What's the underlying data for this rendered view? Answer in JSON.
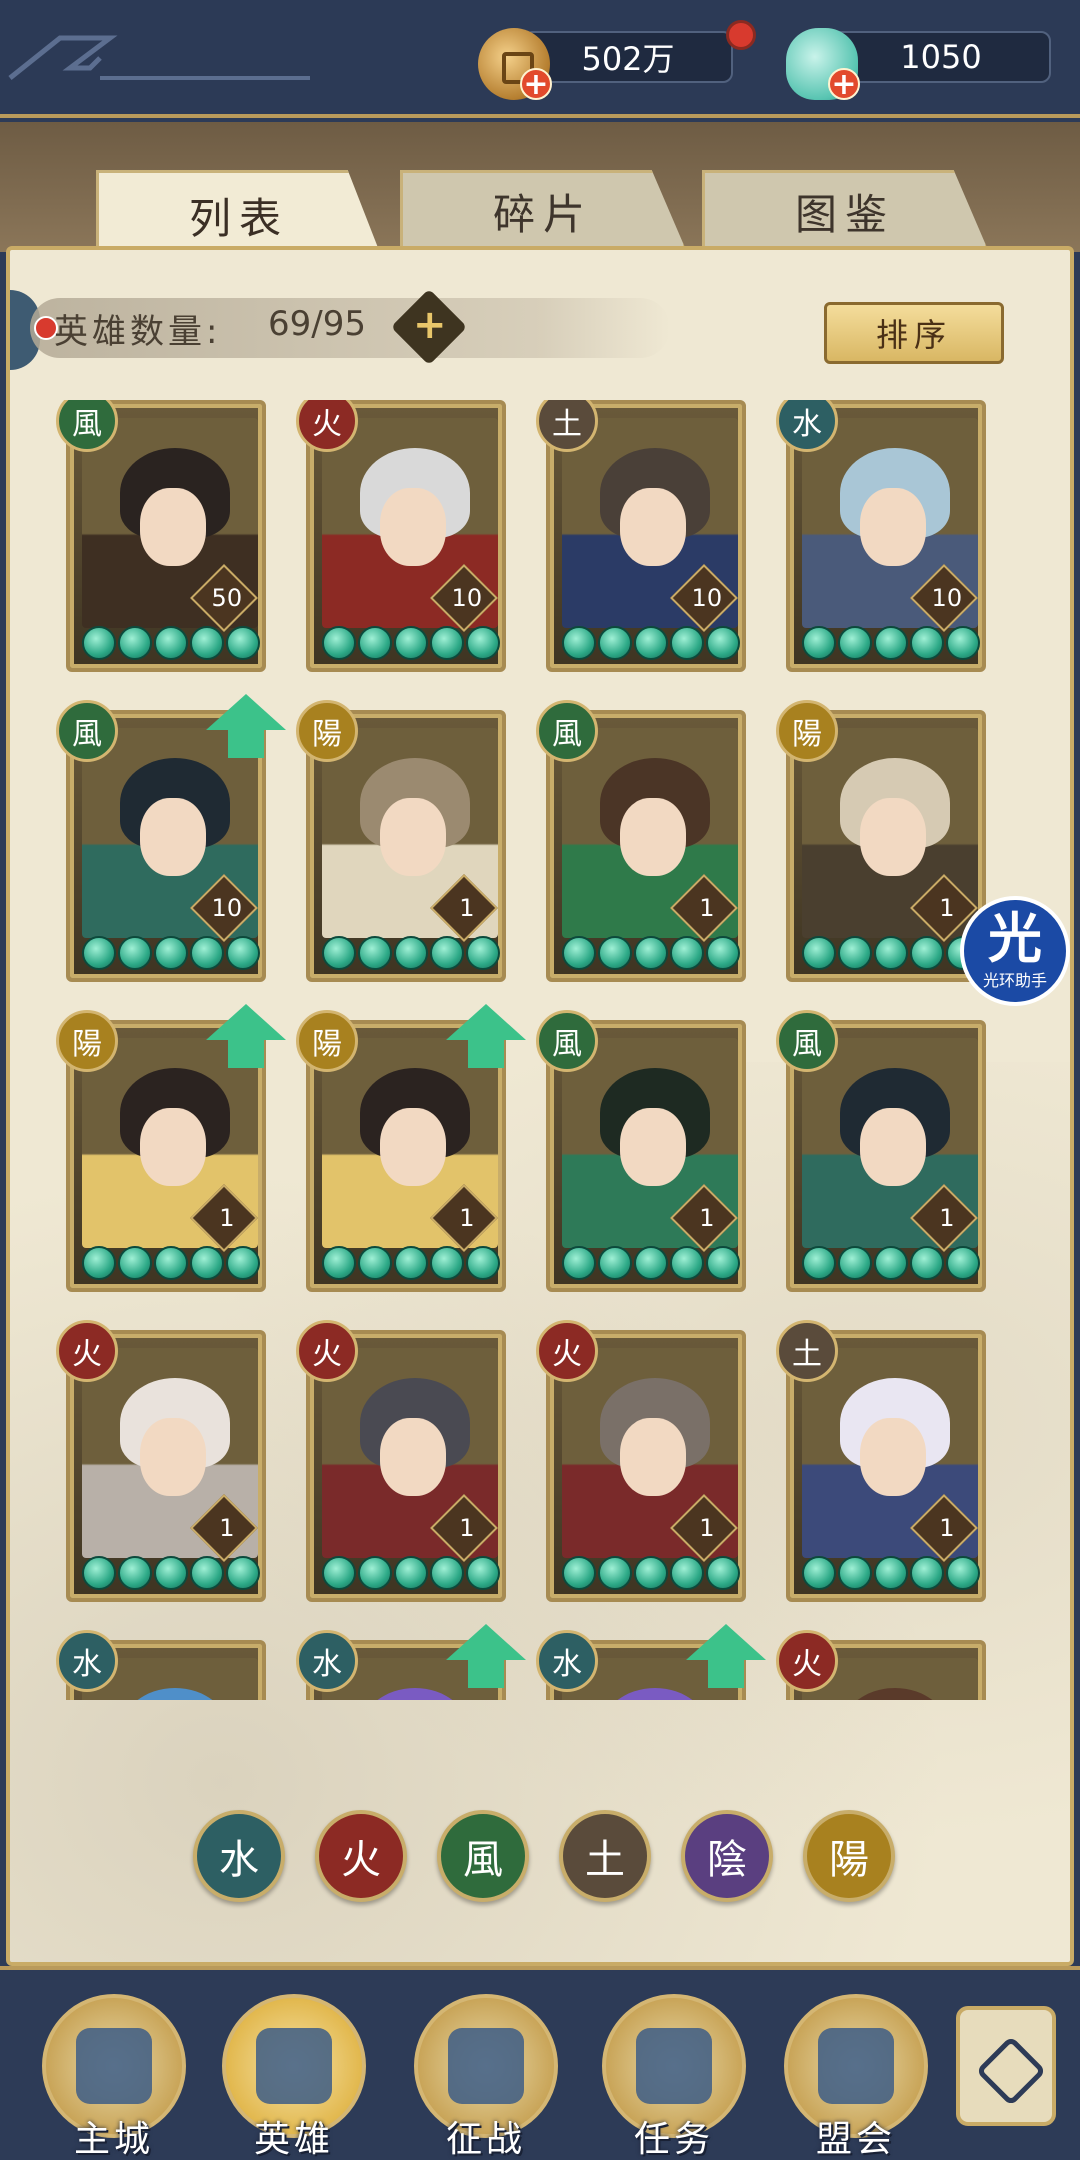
{
  "currency": {
    "gold": "502万",
    "jade": "1050",
    "plus_symbol": "+"
  },
  "tabs": [
    {
      "label": "列表",
      "active": true
    },
    {
      "label": "碎片",
      "active": false
    },
    {
      "label": "图鉴",
      "active": false
    }
  ],
  "hero_count": {
    "label": "英雄数量:",
    "value": "69/95",
    "plus_symbol": "+"
  },
  "sort_button": "排序",
  "element_glyphs": {
    "water": "水",
    "fire": "火",
    "wind": "風",
    "earth": "土",
    "yin": "陰",
    "yang": "陽"
  },
  "heroes": [
    {
      "element": "wind",
      "level": "50",
      "stars": 5,
      "upgrade": false
    },
    {
      "element": "fire",
      "level": "10",
      "stars": 5,
      "upgrade": false
    },
    {
      "element": "earth",
      "level": "10",
      "stars": 5,
      "upgrade": false
    },
    {
      "element": "water",
      "level": "10",
      "stars": 5,
      "upgrade": false
    },
    {
      "element": "wind",
      "level": "10",
      "stars": 5,
      "upgrade": true
    },
    {
      "element": "yang",
      "level": "1",
      "stars": 5,
      "upgrade": false
    },
    {
      "element": "wind",
      "level": "1",
      "stars": 5,
      "upgrade": false
    },
    {
      "element": "yang",
      "level": "1",
      "stars": 5,
      "upgrade": false
    },
    {
      "element": "yang",
      "level": "1",
      "stars": 5,
      "upgrade": true
    },
    {
      "element": "yang",
      "level": "1",
      "stars": 5,
      "upgrade": true
    },
    {
      "element": "wind",
      "level": "1",
      "stars": 5,
      "upgrade": false
    },
    {
      "element": "wind",
      "level": "1",
      "stars": 5,
      "upgrade": false
    },
    {
      "element": "fire",
      "level": "1",
      "stars": 5,
      "upgrade": false
    },
    {
      "element": "fire",
      "level": "1",
      "stars": 5,
      "upgrade": false
    },
    {
      "element": "fire",
      "level": "1",
      "stars": 5,
      "upgrade": false
    },
    {
      "element": "earth",
      "level": "1",
      "stars": 5,
      "upgrade": false
    },
    {
      "element": "water",
      "level": "",
      "stars": 0,
      "upgrade": false
    },
    {
      "element": "water",
      "level": "",
      "stars": 0,
      "upgrade": true
    },
    {
      "element": "water",
      "level": "",
      "stars": 0,
      "upgrade": true
    },
    {
      "element": "fire",
      "level": "",
      "stars": 0,
      "upgrade": false
    }
  ],
  "filters": [
    "water",
    "fire",
    "wind",
    "earth",
    "yin",
    "yang"
  ],
  "bottom_nav": [
    {
      "label": "主城",
      "icon": "city-icon",
      "active": false
    },
    {
      "label": "英雄",
      "icon": "hero-icon",
      "active": true
    },
    {
      "label": "征战",
      "icon": "battle-icon",
      "active": false
    },
    {
      "label": "任务",
      "icon": "quest-icon",
      "active": false
    },
    {
      "label": "盟会",
      "icon": "guild-icon",
      "active": false
    }
  ],
  "watermark": {
    "big": "光",
    "small": "光环助手"
  }
}
